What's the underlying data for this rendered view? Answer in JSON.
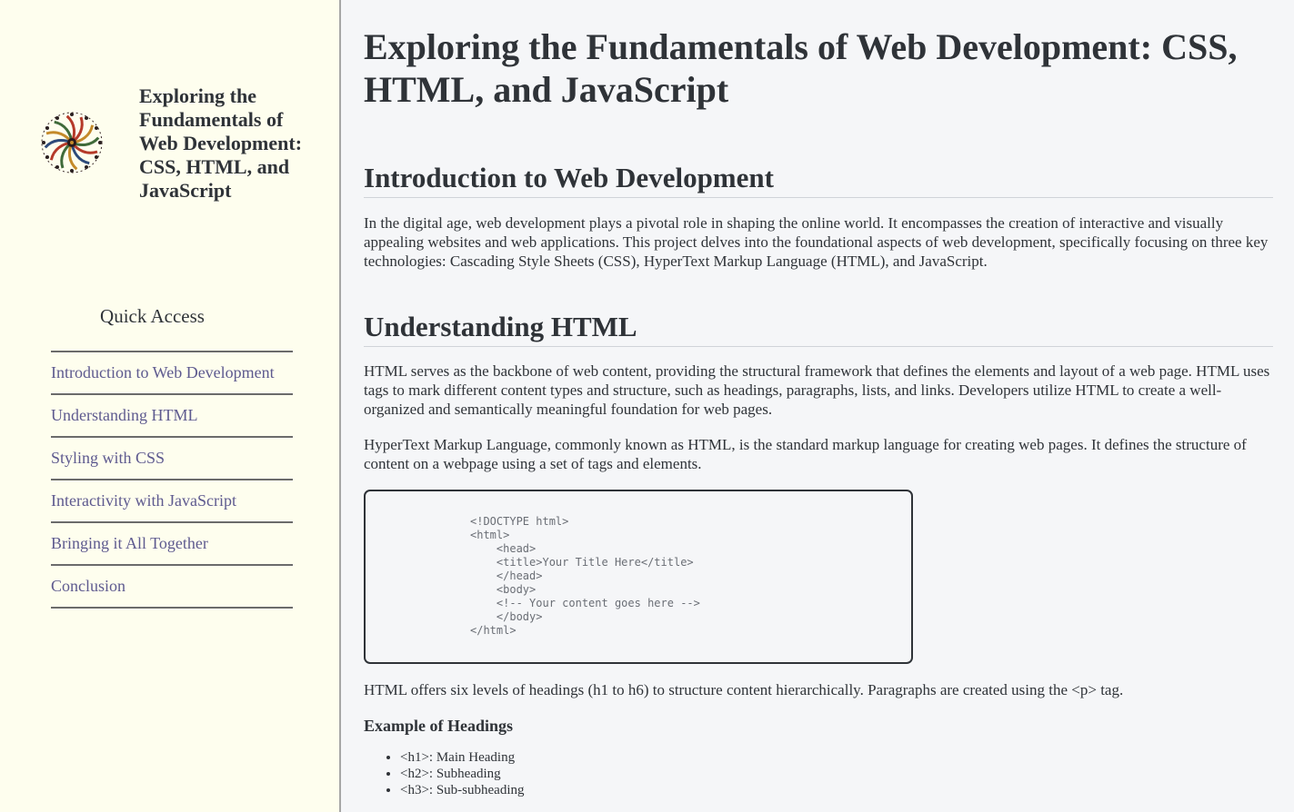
{
  "sidebar": {
    "site_title": "Exploring the Fundamentals of Web Development: CSS, HTML, and JavaScript",
    "quick_access_title": "Quick Access",
    "nav_items": [
      "Introduction to Web Development",
      "Understanding HTML",
      "Styling with CSS",
      "Interactivity with JavaScript",
      "Bringing it All Together",
      "Conclusion"
    ]
  },
  "main": {
    "title": "Exploring the Fundamentals of Web Development: CSS, HTML, and JavaScript",
    "intro": {
      "heading": "Introduction to Web Development",
      "paragraph": "In the digital age, web development plays a pivotal role in shaping the online world. It encompasses the creation of interactive and visually appealing websites and web applications. This project delves into the foundational aspects of web development, specifically focusing on three key technologies: Cascading Style Sheets (CSS), HyperText Markup Language (HTML), and JavaScript."
    },
    "html_section": {
      "heading": "Understanding HTML",
      "paragraph1": "HTML serves as the backbone of web content, providing the structural framework that defines the elements and layout of a web page. HTML uses tags to mark different content types and structure, such as headings, paragraphs, lists, and links. Developers utilize HTML to create a well-organized and semantically meaningful foundation for web pages.",
      "paragraph2": "HyperText Markup Language, commonly known as HTML, is the standard markup language for creating web pages. It defines the structure of content on a webpage using a set of tags and elements.",
      "code": "<!DOCTYPE html>\n<html>\n    <head>\n    <title>Your Title Here</title>\n    </head>\n    <body>\n    <!-- Your content goes here -->\n    </body>\n</html>",
      "paragraph3": "HTML offers six levels of headings (h1 to h6) to structure content hierarchically. Paragraphs are created using the <p> tag.",
      "example_title": "Example of Headings",
      "example_items": [
        "<h1>: Main Heading",
        "<h2>: Subheading",
        "<h3>: Sub-subheading"
      ]
    }
  },
  "colors": {
    "sidebar_bg": "#fefeee",
    "main_bg": "#f5f6f8",
    "link": "#5e5a8f",
    "text": "#2f3338"
  }
}
